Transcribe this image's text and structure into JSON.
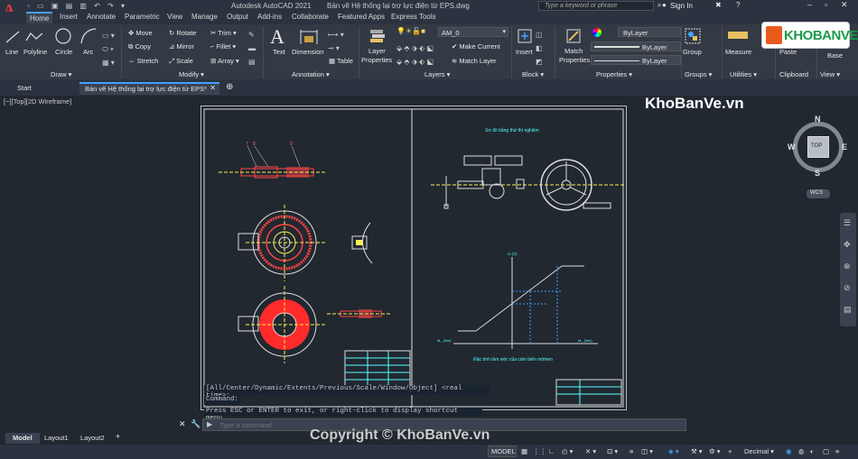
{
  "title": {
    "app": "Autodesk AutoCAD 2021",
    "file": "Bản vẽ Hệ thống lại trợ lực điện từ EPS.dwg",
    "search_placeholder": "Type a keyword or phrase",
    "sign_in": "Sign In"
  },
  "ribbon_tabs": [
    "Home",
    "Insert",
    "Annotate",
    "Parametric",
    "View",
    "Manage",
    "Output",
    "Add-ins",
    "Collaborate",
    "Featured Apps",
    "Express Tools"
  ],
  "draw": {
    "line": "Line",
    "polyline": "Polyline",
    "circle": "Circle",
    "arc": "Arc",
    "label": "Draw ▾"
  },
  "modify": {
    "move": "Move",
    "rotate": "Rotate",
    "trim": "Trim ▾",
    "copy": "Copy",
    "mirror": "Mirror",
    "fillet": "Fillet ▾",
    "stretch": "Stretch",
    "scale": "Scale",
    "array": "Array ▾",
    "label": "Modify ▾"
  },
  "annotation": {
    "text": "Text",
    "dimension": "Dimension",
    "table": "Table",
    "label": "Annotation ▾"
  },
  "layers": {
    "layer_props": "Layer",
    "layer_props2": "Properties",
    "current": "AM_0",
    "make_current": "Make Current",
    "match_layer": "Match Layer",
    "label": "Layers ▾"
  },
  "block": {
    "insert": "Insert",
    "label": "Block ▾"
  },
  "properties": {
    "match": "Match",
    "match2": "Properties",
    "bylayer1": "ByLayer",
    "bylayer2": "ByLayer",
    "bylayer3": "ByLayer",
    "label": "Properties ▾"
  },
  "groups": {
    "group": "Group",
    "label": "Groups ▾"
  },
  "utilities": {
    "measure": "Measure",
    "label": "Utilities ▾"
  },
  "clipboard": {
    "paste": "Paste",
    "label": "Clipboard"
  },
  "view": {
    "base": "Base",
    "label": "View ▾"
  },
  "file_tabs": {
    "start": "Start",
    "drawing": "Bản vẽ Hệ thống lại trợ lực điện từ EPS*"
  },
  "viewport_label": "[−][Top][2D Wireframe]",
  "viewcube": {
    "n": "N",
    "s": "S",
    "e": "E",
    "w": "W",
    "top": "TOP",
    "wcs": "WCS"
  },
  "watermark": {
    "site": "KhoBanVe.vn",
    "logo": "KHOBANVE",
    "copyright": "Copyright © KhoBanVe.vn"
  },
  "drawing_text": {
    "title1": "Sơ đồ bằng thử thí nghiệm",
    "title2": "Đặc tính làm việc của cảm biến mômen",
    "axis_u": "U (V)",
    "axis_m1": "M_ (Nm)",
    "axis_m2": "M_ (Nm)"
  },
  "command": {
    "history1": "[All/Center/Dynamic/Extents/Previous/Scale/Window/Object] <real time>:",
    "history2": "Command:",
    "history3": "Press ESC or ENTER to exit, or right-click to display shortcut menu.",
    "placeholder": "Type a command"
  },
  "layout_tabs": [
    "Model",
    "Layout1",
    "Layout2"
  ],
  "status": {
    "model": "MODEL",
    "units": "Decimal"
  }
}
